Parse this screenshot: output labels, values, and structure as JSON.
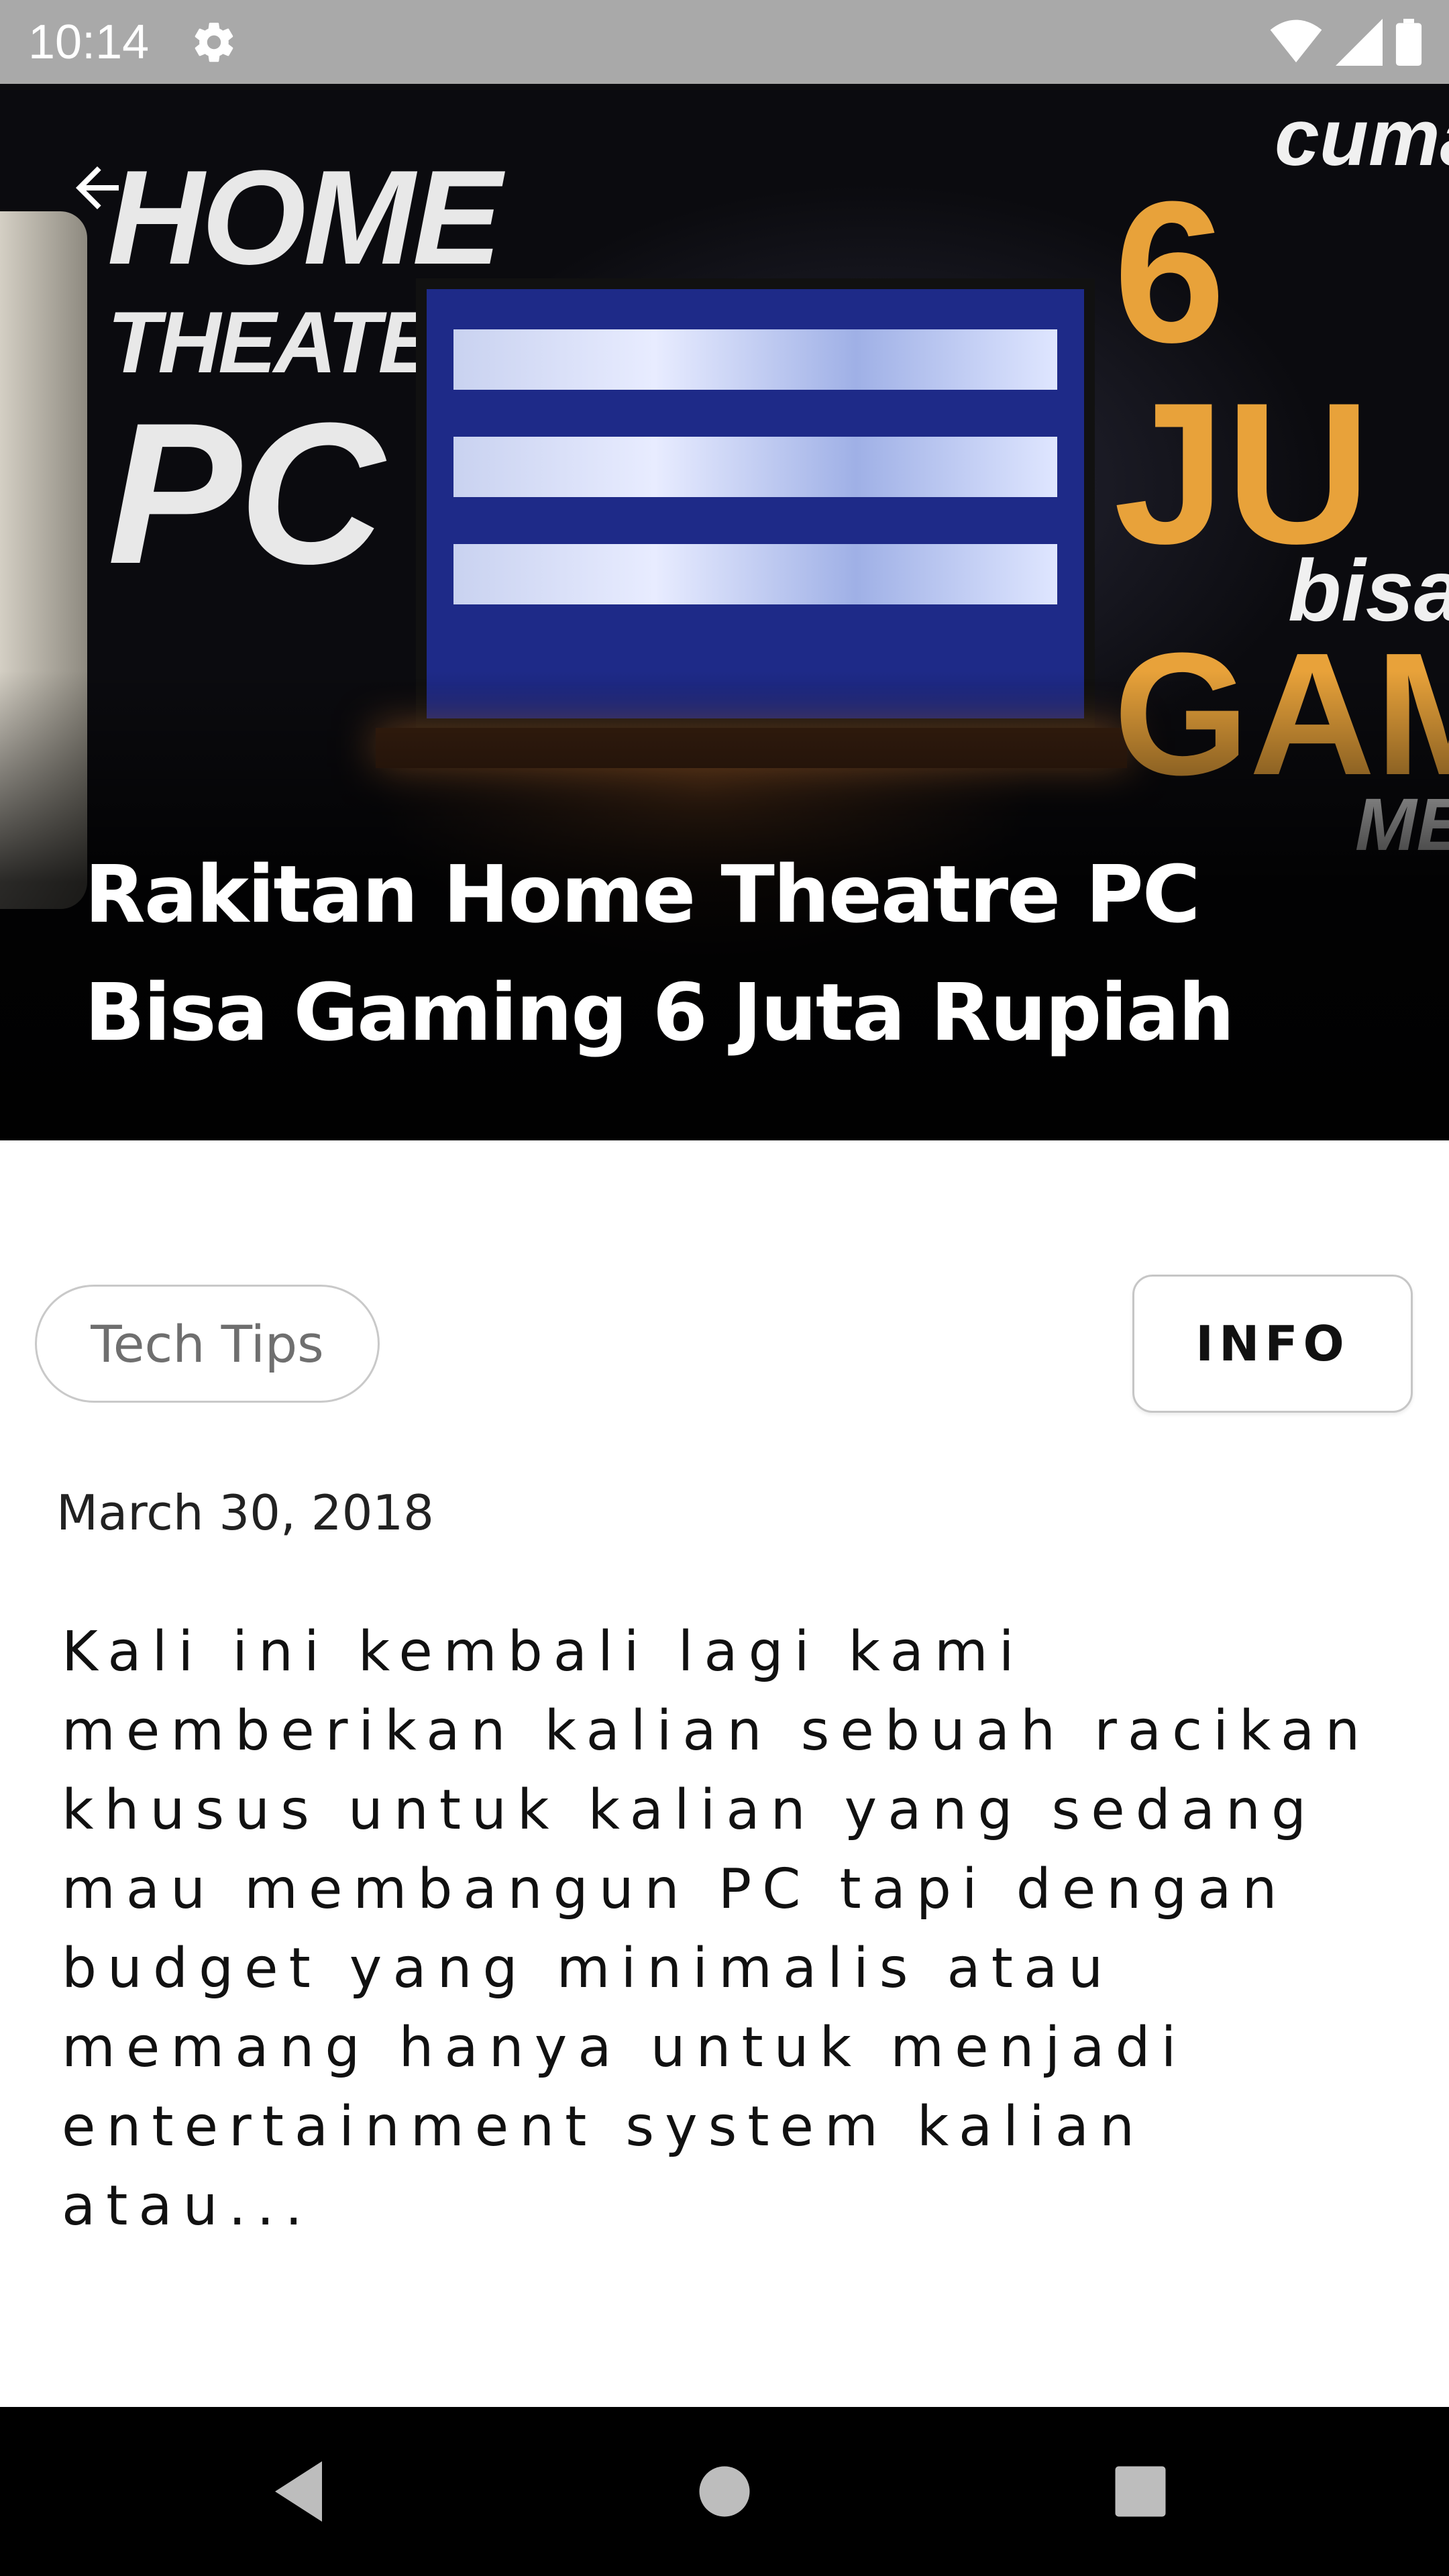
{
  "status_bar": {
    "time": "10:14",
    "icons": [
      "settings-gear-icon",
      "wifi-icon",
      "signal-icon",
      "battery-icon"
    ]
  },
  "hero": {
    "title": "Rakitan Home Theatre PC Bisa Gaming 6 Juta Rupiah",
    "image_text_left": [
      "HOME",
      "THEATER",
      "PC"
    ],
    "image_text_right": [
      "cuma",
      "6 JU",
      "bisa",
      "GAMI",
      "ME"
    ],
    "back_icon": "arrow-left-icon"
  },
  "post": {
    "category": "Tech Tips",
    "info_label": "INFO",
    "date": "March 30, 2018",
    "excerpt": "Kali ini kembali lagi kami memberikan kalian sebuah racikan khusus untuk kalian yang sedang mau membangun PC tapi dengan budget yang minimalis atau memang hanya untuk menjadi entertainment system kalian atau..."
  },
  "nav_bar": {
    "icons": [
      "back-triangle-icon",
      "home-circle-icon",
      "recents-square-icon"
    ]
  },
  "colors": {
    "status_bar_bg": "#a9a9a9",
    "nav_bar_bg": "#000000",
    "chip_border": "#c9c9c9",
    "accent_orange": "#e8a23a"
  }
}
